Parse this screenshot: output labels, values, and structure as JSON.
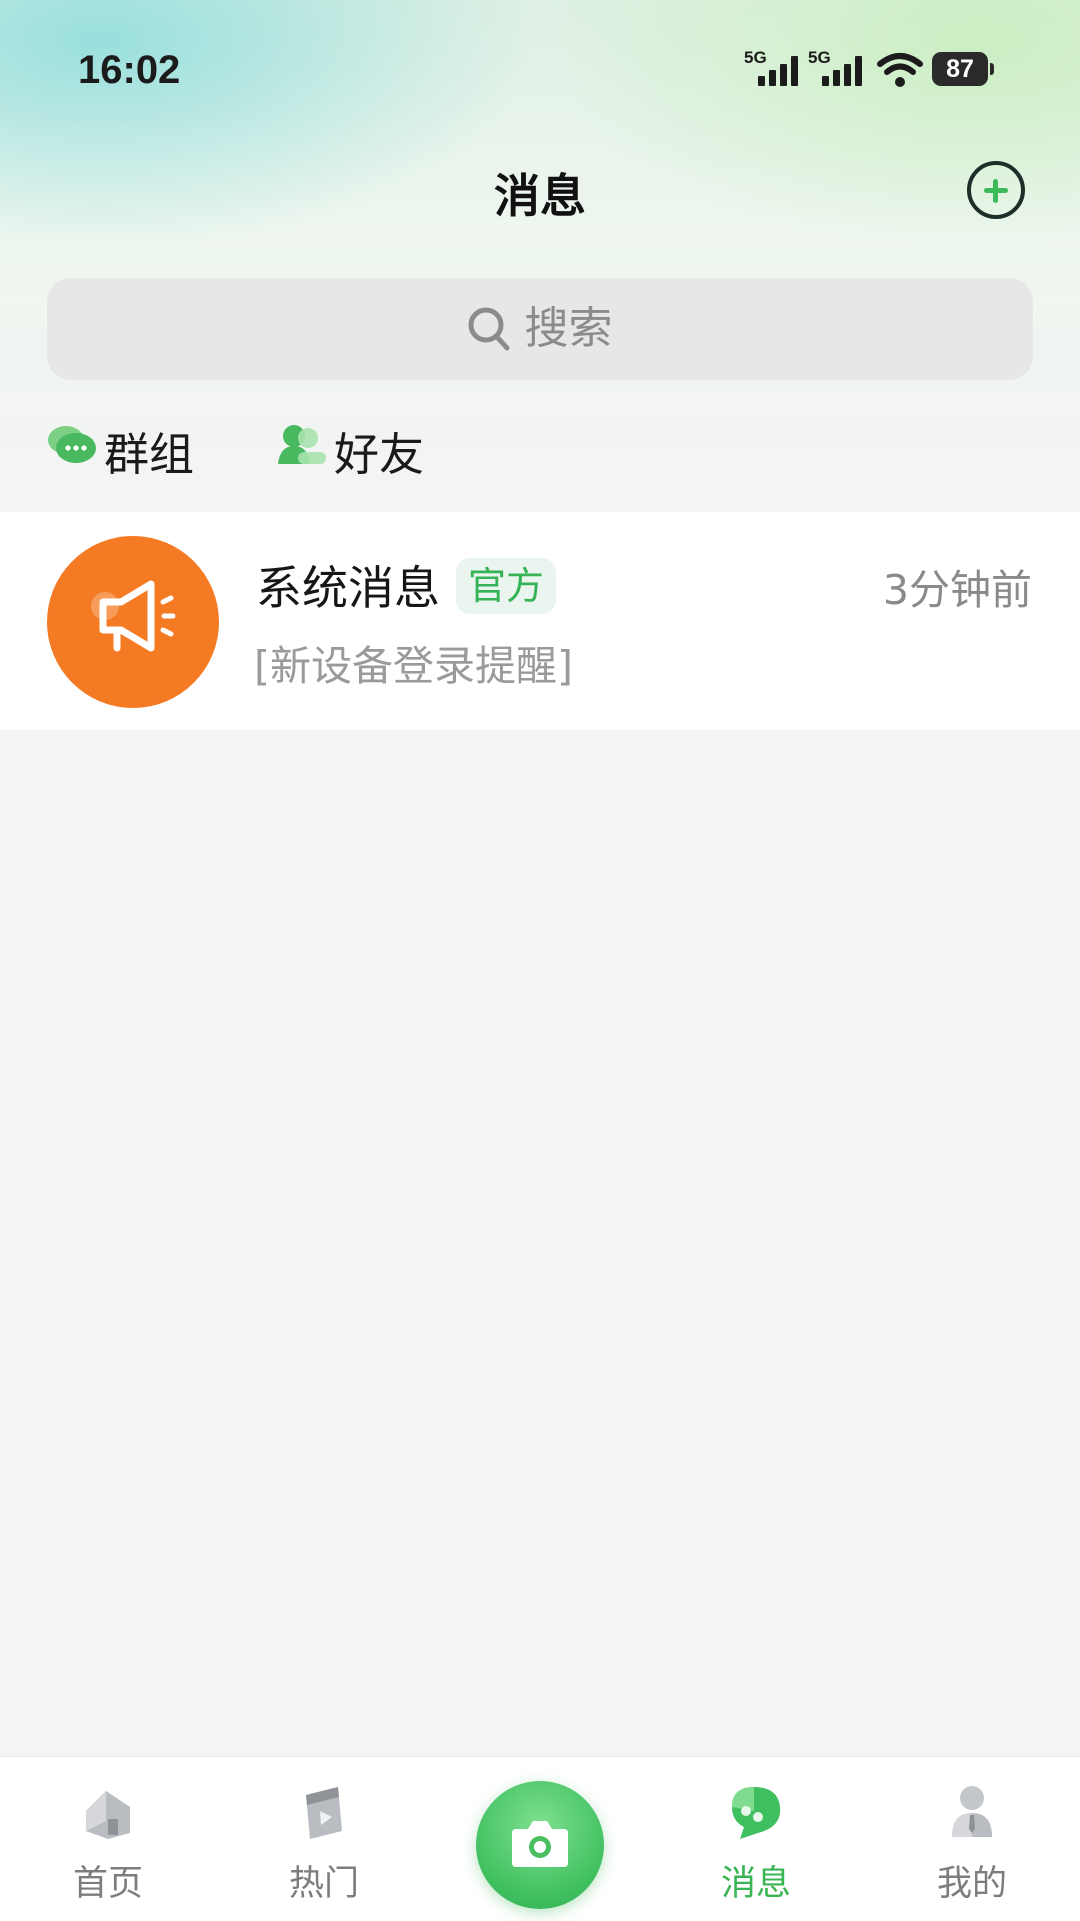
{
  "status_bar": {
    "time": "16:02",
    "signal1_label": "5G",
    "signal2_label": "5G",
    "battery": "87"
  },
  "header": {
    "title": "消息",
    "add_icon": "plus-circle-icon"
  },
  "search": {
    "placeholder": "搜索",
    "icon": "search-icon"
  },
  "quick_links": [
    {
      "label": "群组",
      "icon": "group-chat-icon"
    },
    {
      "label": "好友",
      "icon": "friends-icon"
    }
  ],
  "conversations": [
    {
      "name": "系统消息",
      "badge": "官方",
      "time": "3分钟前",
      "preview": "[新设备登录提醒]",
      "avatar_icon": "megaphone-icon",
      "avatar_color": "#f47b23"
    }
  ],
  "tabbar": {
    "active": "消息",
    "accent_color": "#39b653",
    "items": [
      {
        "label": "首页",
        "icon": "home-icon"
      },
      {
        "label": "热门",
        "icon": "video-icon"
      },
      {
        "label": "",
        "icon": "camera-icon"
      },
      {
        "label": "消息",
        "icon": "message-icon"
      },
      {
        "label": "我的",
        "icon": "profile-icon"
      }
    ]
  }
}
